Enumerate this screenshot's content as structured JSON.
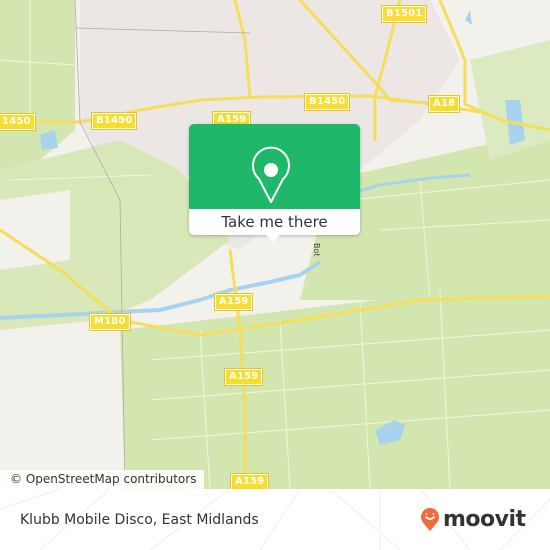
{
  "map": {
    "attribution": "© OpenStreetMap contributors",
    "road_labels": [
      {
        "id": "b1501",
        "text": "B1501"
      },
      {
        "id": "b1450-left",
        "text": "B1450"
      },
      {
        "id": "b1450-edge",
        "text": "1450"
      },
      {
        "id": "b1450-right",
        "text": "B1450"
      },
      {
        "id": "a159-top",
        "text": "A159"
      },
      {
        "id": "a18",
        "text": "A18"
      },
      {
        "id": "a159-mid",
        "text": "A159"
      },
      {
        "id": "m180",
        "text": "M180"
      },
      {
        "id": "a159-lower",
        "text": "A159"
      },
      {
        "id": "a159-bottom",
        "text": "A159"
      }
    ],
    "street_label": "Bot",
    "colors": {
      "land": "#f2f1ec",
      "urban": "#ece6e4",
      "green": "#d3e6b0",
      "water": "#a7d3ec",
      "road": "#f6dd5a"
    }
  },
  "popup": {
    "icon": "location-pin-icon",
    "action_label": "Take me there",
    "color": "#1fb86a"
  },
  "footer": {
    "place_name": "Klubb Mobile Disco, East Midlands",
    "brand": "moovit",
    "brand_color": "#f26b3a"
  }
}
